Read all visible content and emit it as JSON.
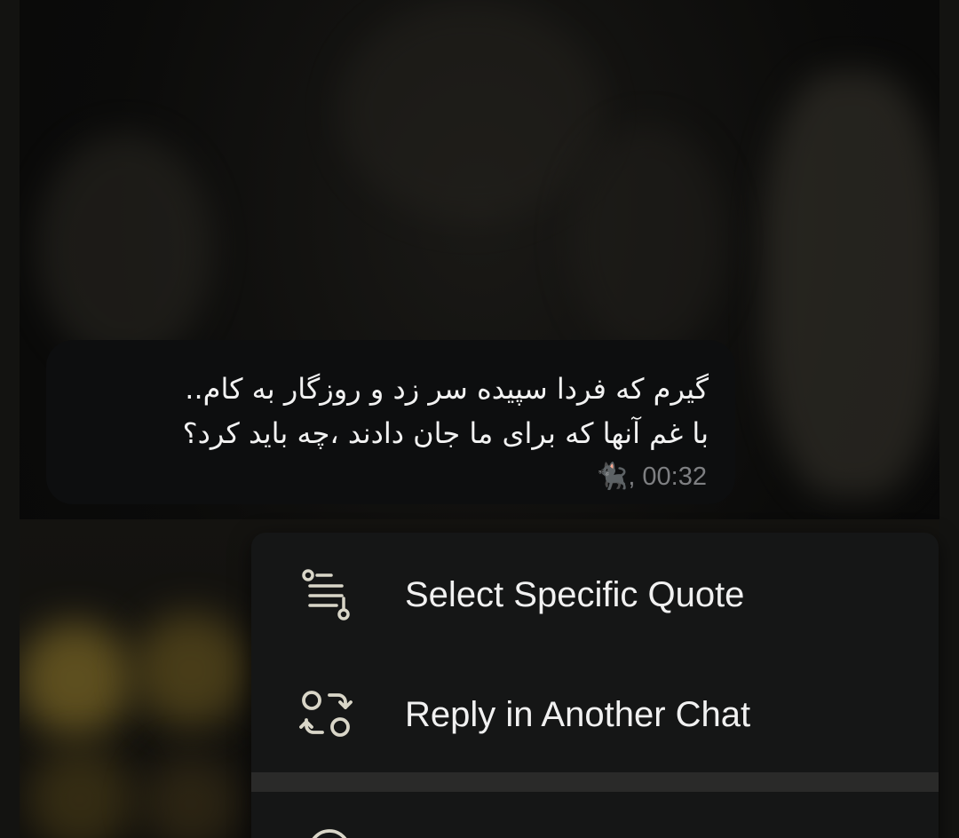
{
  "message": {
    "lines": [
      "گیرم که فردا سپیده سر زد و روزگار به کام..",
      "با غم آنها که برای ما جان دادند ،چه باید کرد؟"
    ],
    "sender_emoji": "🐈‍⬛",
    "time": ", 00:32"
  },
  "context_menu": {
    "items": [
      {
        "label": "Select Specific Quote",
        "icon": "select-quote-icon"
      },
      {
        "label": "Reply in Another Chat",
        "icon": "reply-another-chat-icon"
      }
    ],
    "partial_item_icon": "partially-visible-icon"
  },
  "colors": {
    "menu_bg": "#151616",
    "bubble_bg": "#0d0e0f",
    "icon_color": "#d9d6c8",
    "time_color": "#7e7f82"
  }
}
